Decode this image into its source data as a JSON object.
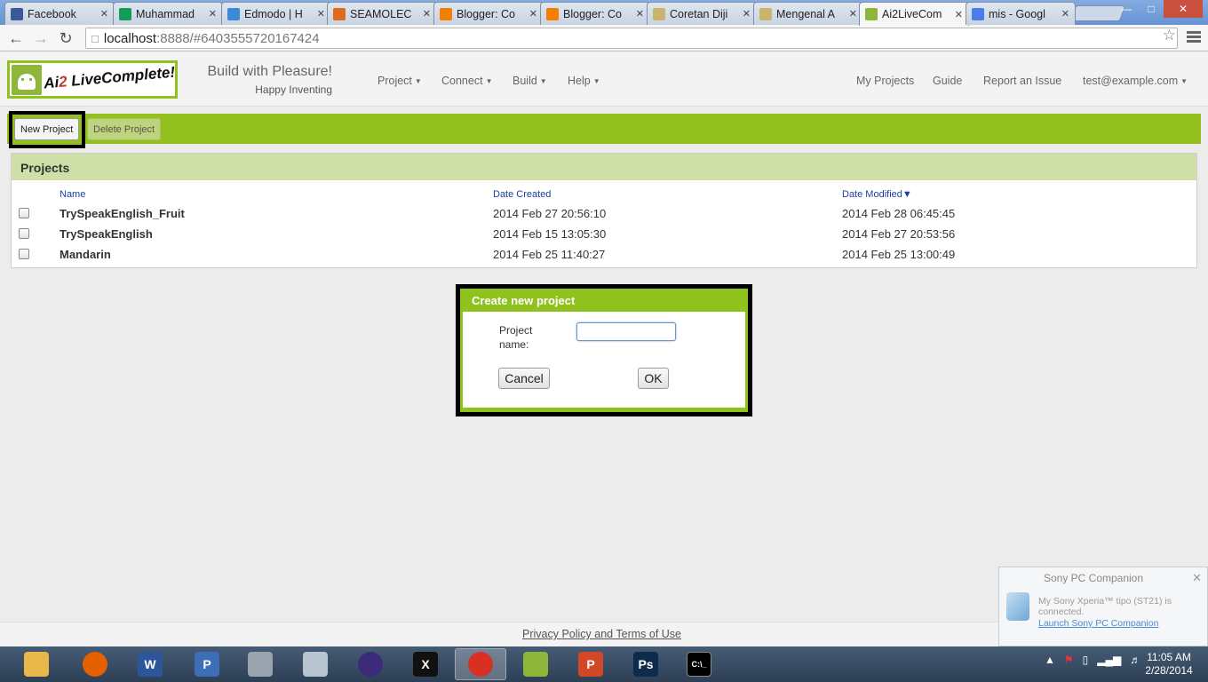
{
  "browser": {
    "tabs": [
      {
        "title": "Facebook",
        "icon": "facebook-icon",
        "color": "#3b5998"
      },
      {
        "title": "Muhammad",
        "icon": "sheets-icon",
        "color": "#0f9d58"
      },
      {
        "title": "Edmodo | H",
        "icon": "edmodo-icon",
        "color": "#3a8ad6"
      },
      {
        "title": "SEAMOLEC",
        "icon": "seamolec-icon",
        "color": "#e06a1b"
      },
      {
        "title": "Blogger: Co",
        "icon": "blogger-icon",
        "color": "#f57d00"
      },
      {
        "title": "Blogger: Co",
        "icon": "blogger-icon",
        "color": "#f57d00"
      },
      {
        "title": "Coretan Diji",
        "icon": "page-icon",
        "color": "#c9b46b"
      },
      {
        "title": "Mengenal A",
        "icon": "page-icon",
        "color": "#c9b46b"
      },
      {
        "title": "Ai2LiveCom",
        "icon": "ai2-icon",
        "color": "#8db63b"
      },
      {
        "title": "mis - Googl",
        "icon": "google-icon",
        "color": "#4a7ee6"
      }
    ],
    "url_host": "localhost",
    "url_rest": ":8888/#6403555720167424"
  },
  "app": {
    "logo_prefix": "Ai",
    "logo_two": "2",
    "logo_suffix": " LiveComplete!",
    "tagline": "Build with Pleasure!",
    "subtagline": "Happy Inventing",
    "menu": {
      "project": "Project",
      "connect": "Connect",
      "build": "Build",
      "help": "Help"
    },
    "right_links": {
      "my_projects": "My Projects",
      "guide": "Guide",
      "report": "Report an Issue",
      "user": "test@example.com"
    },
    "toolbar": {
      "new_project": "New Project",
      "delete_project": "Delete Project"
    }
  },
  "projects": {
    "title": "Projects",
    "columns": {
      "name": "Name",
      "created": "Date Created",
      "modified": "Date Modified▼"
    },
    "rows": [
      {
        "name": "TrySpeakEnglish_Fruit",
        "created": "2014 Feb 27 20:56:10",
        "modified": "2014 Feb 28 06:45:45"
      },
      {
        "name": "TrySpeakEnglish",
        "created": "2014 Feb 15 13:05:30",
        "modified": "2014 Feb 27 20:53:56"
      },
      {
        "name": "Mandarin",
        "created": "2014 Feb 25 11:40:27",
        "modified": "2014 Feb 25 13:00:49"
      }
    ]
  },
  "dialog": {
    "title": "Create new project",
    "label": "Project name:",
    "input_value": "",
    "cancel": "Cancel",
    "ok": "OK"
  },
  "footer": {
    "link": "Privacy Policy and Terms of Use"
  },
  "toast": {
    "title": "Sony PC Companion",
    "message": "My Sony Xperia™ tipo (ST21) is connected.",
    "link": "Launch Sony PC Companion"
  },
  "taskbar": {
    "apps": [
      {
        "name": "explorer",
        "icon": "folder-icon",
        "color": "#e8b84a",
        "glyph": "",
        "active": false
      },
      {
        "name": "firefox",
        "icon": "firefox-icon",
        "color": "#e66000",
        "glyph": "",
        "active": false
      },
      {
        "name": "word",
        "icon": "word-icon",
        "color": "#2b579a",
        "glyph": "W",
        "active": false
      },
      {
        "name": "powerpoint-app",
        "icon": "presentation-icon",
        "color": "#3d6fb6",
        "glyph": "P",
        "active": false
      },
      {
        "name": "network",
        "icon": "network-icon",
        "color": "#9aa3ad",
        "glyph": "",
        "active": false
      },
      {
        "name": "monitor",
        "icon": "monitor-icon",
        "color": "#b8c4cf",
        "glyph": "",
        "active": false
      },
      {
        "name": "eclipse",
        "icon": "eclipse-icon",
        "color": "#3d2a7a",
        "glyph": "",
        "active": false
      },
      {
        "name": "xming",
        "icon": "x-icon",
        "color": "#111111",
        "glyph": "X",
        "active": false
      },
      {
        "name": "chrome",
        "icon": "chrome-icon",
        "color": "#d93025",
        "glyph": "",
        "active": true
      },
      {
        "name": "ai2",
        "icon": "android-icon",
        "color": "#8db63b",
        "glyph": "",
        "active": false
      },
      {
        "name": "powerpoint",
        "icon": "powerpoint-icon",
        "color": "#d24726",
        "glyph": "P",
        "active": false
      },
      {
        "name": "photoshop",
        "icon": "photoshop-icon",
        "color": "#0d2b4a",
        "glyph": "Ps",
        "active": false
      },
      {
        "name": "cmd",
        "icon": "terminal-icon",
        "color": "#000000",
        "glyph": "C:\\_",
        "active": false
      }
    ],
    "time": "11:05 AM",
    "date": "2/28/2014"
  }
}
